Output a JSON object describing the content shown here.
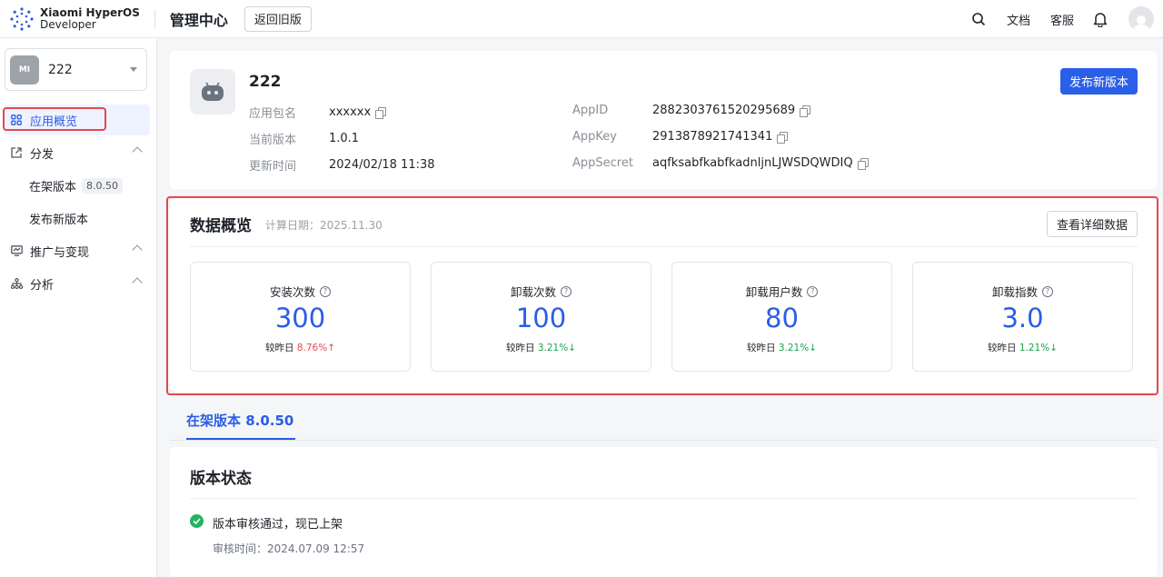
{
  "header": {
    "logo_line1": "Xiaomi HyperOS",
    "logo_line2": "Developer",
    "title": "管理中心",
    "old_version_button": "返回旧版",
    "docs": "文档",
    "support": "客服"
  },
  "sidebar": {
    "app_name": "222",
    "app_thumb_text": "MI",
    "items": [
      {
        "label": "应用概览",
        "icon": "grid-icon",
        "active": true
      },
      {
        "label": "分发",
        "icon": "external-link-icon"
      },
      {
        "label": "推广与变现",
        "icon": "chart-icon"
      },
      {
        "label": "分析",
        "icon": "hierarchy-icon"
      }
    ],
    "sub_items": [
      {
        "label": "在架版本",
        "tag": "8.0.50"
      },
      {
        "label": "发布新版本"
      }
    ]
  },
  "app": {
    "name": "222",
    "publish_button": "发布新版本",
    "package_label": "应用包名",
    "package_value": "xxxxxx",
    "version_label": "当前版本",
    "version_value": "1.0.1",
    "updated_label": "更新时间",
    "updated_value": "2024/02/18 11:38",
    "appid_label": "AppID",
    "appid_value": "2882303761520295689",
    "appkey_label": "AppKey",
    "appkey_value": "2913878921741341",
    "appsecret_label": "AppSecret",
    "appsecret_value": "aqfksabfkabfkadnljnLJWSDQWDIQ"
  },
  "overview": {
    "title": "数据概览",
    "calc_date": "计算日期：2025.11.30",
    "detail_button": "查看详细数据",
    "compare_label": "较昨日",
    "stats": [
      {
        "label": "安装次数",
        "value": "300",
        "change": "8.76%",
        "direction": "up"
      },
      {
        "label": "卸载次数",
        "value": "100",
        "change": "3.21%",
        "direction": "down"
      },
      {
        "label": "卸载用户数",
        "value": "80",
        "change": "3.21%",
        "direction": "down"
      },
      {
        "label": "卸载指数",
        "value": "3.0",
        "change": "1.21%",
        "direction": "down"
      }
    ]
  },
  "tab": {
    "label": "在架版本 8.0.50"
  },
  "status": {
    "title": "版本状态",
    "message": "版本审核通过，现已上架",
    "review_time": "审核时间：2024.07.09 12:57"
  },
  "colors": {
    "accent": "#2b5de6",
    "up": "#e5484d",
    "down": "#17a34a",
    "highlight_border": "#e5484d",
    "success": "#22b35e"
  }
}
